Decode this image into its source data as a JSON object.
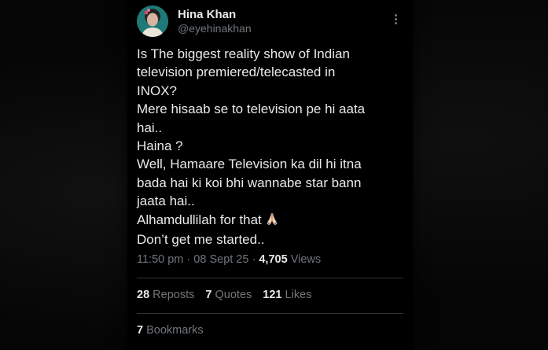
{
  "tweet": {
    "author_name": "Hina Khan",
    "author_handle": "@eyehinakhan",
    "more_icon": "more-vertical-icon",
    "lines": [
      "Is The biggest reality show of Indian",
      "television premiered/telecasted in",
      "INOX?",
      "Mere hisaab se to television pe hi aata",
      "hai..",
      "Haina ?",
      "Well, Hamaare Television ka dil hi itna",
      "bada hai ki koi bhi wannabe star bann",
      "jaata hai..",
      "Alhamdullilah for that",
      "Don’t get me started.."
    ],
    "emoji_icon": "folded-hands-icon",
    "time": "11:50 pm",
    "date": "08 Sept 25",
    "separator": "·",
    "views_count": "4,705",
    "views_label": "Views"
  },
  "stats": {
    "reposts_count": "28",
    "reposts_label": "Reposts",
    "quotes_count": "7",
    "quotes_label": "Quotes",
    "likes_count": "121",
    "likes_label": "Likes",
    "bookmarks_count": "7",
    "bookmarks_label": "Bookmarks"
  },
  "colors": {
    "background": "#000000",
    "primary_text": "#e7e9ea",
    "secondary_text": "#71767b",
    "divider": "#2f3336"
  }
}
